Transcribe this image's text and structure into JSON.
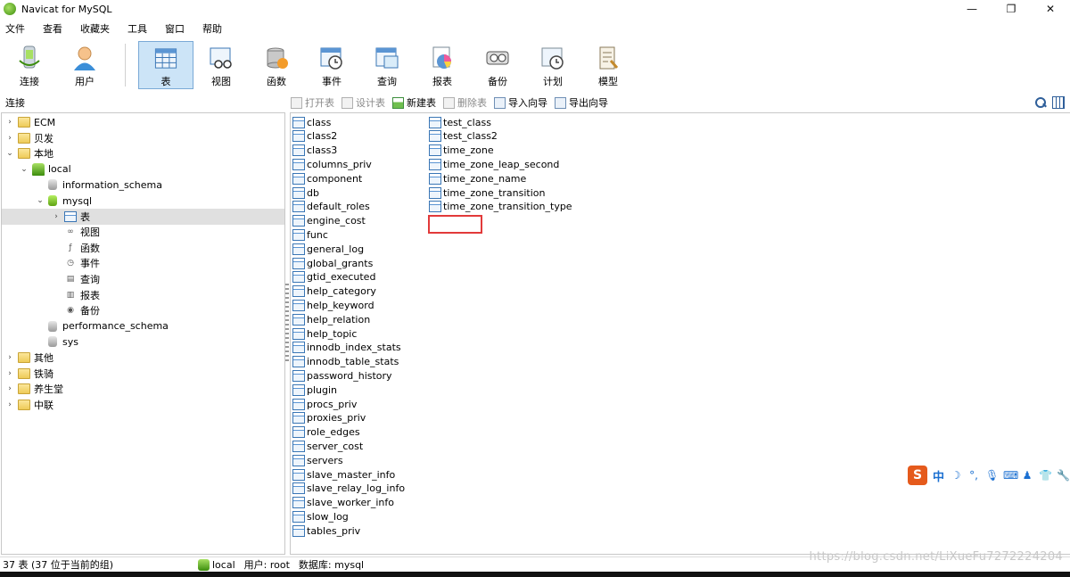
{
  "window": {
    "title": "Navicat for MySQL"
  },
  "menu": [
    "文件",
    "查看",
    "收藏夹",
    "工具",
    "窗口",
    "帮助"
  ],
  "toolbar": {
    "primary": [
      {
        "label": "连接",
        "icon": "connection-icon"
      },
      {
        "label": "用户",
        "icon": "user-icon"
      }
    ],
    "secondary": [
      {
        "label": "表",
        "icon": "table-icon",
        "active": true
      },
      {
        "label": "视图",
        "icon": "view-icon"
      },
      {
        "label": "函数",
        "icon": "function-icon"
      },
      {
        "label": "事件",
        "icon": "event-icon"
      },
      {
        "label": "查询",
        "icon": "query-icon"
      },
      {
        "label": "报表",
        "icon": "report-icon"
      },
      {
        "label": "备份",
        "icon": "backup-icon"
      },
      {
        "label": "计划",
        "icon": "schedule-icon"
      },
      {
        "label": "模型",
        "icon": "model-icon"
      }
    ]
  },
  "left_panel": {
    "header": "连接"
  },
  "tree": [
    {
      "label": "ECM",
      "level": 0,
      "arrow": "›",
      "icon": "folder"
    },
    {
      "label": "贝发",
      "level": 0,
      "arrow": "›",
      "icon": "folder"
    },
    {
      "label": "本地",
      "level": 0,
      "arrow": "⌄",
      "icon": "folder"
    },
    {
      "label": "local",
      "level": 1,
      "arrow": "⌄",
      "icon": "server"
    },
    {
      "label": "information_schema",
      "level": 2,
      "arrow": "",
      "icon": "db"
    },
    {
      "label": "mysql",
      "level": 2,
      "arrow": "⌄",
      "icon": "db-open"
    },
    {
      "label": "表",
      "level": 3,
      "arrow": "›",
      "icon": "table",
      "selected": true
    },
    {
      "label": "视图",
      "level": 3,
      "arrow": "",
      "icon": "view"
    },
    {
      "label": "函数",
      "level": 3,
      "arrow": "",
      "icon": "function"
    },
    {
      "label": "事件",
      "level": 3,
      "arrow": "",
      "icon": "event"
    },
    {
      "label": "查询",
      "level": 3,
      "arrow": "",
      "icon": "query"
    },
    {
      "label": "报表",
      "level": 3,
      "arrow": "",
      "icon": "report"
    },
    {
      "label": "备份",
      "level": 3,
      "arrow": "",
      "icon": "backup"
    },
    {
      "label": "performance_schema",
      "level": 2,
      "arrow": "",
      "icon": "db"
    },
    {
      "label": "sys",
      "level": 2,
      "arrow": "",
      "icon": "db"
    },
    {
      "label": "其他",
      "level": 0,
      "arrow": "›",
      "icon": "folder"
    },
    {
      "label": "铁骑",
      "level": 0,
      "arrow": "›",
      "icon": "folder"
    },
    {
      "label": "养生堂",
      "level": 0,
      "arrow": "›",
      "icon": "folder"
    },
    {
      "label": "中联",
      "level": 0,
      "arrow": "›",
      "icon": "folder"
    }
  ],
  "object_toolbar": [
    {
      "label": "打开表",
      "enabled": false
    },
    {
      "label": "设计表",
      "enabled": false
    },
    {
      "label": "新建表",
      "enabled": true
    },
    {
      "label": "删除表",
      "enabled": false
    },
    {
      "label": "导入向导",
      "enabled": true
    },
    {
      "label": "导出向导",
      "enabled": true
    }
  ],
  "tables_col1": [
    "class",
    "class2",
    "class3",
    "columns_priv",
    "component",
    "db",
    "default_roles",
    "engine_cost",
    "func",
    "general_log",
    "global_grants",
    "gtid_executed",
    "help_category",
    "help_keyword",
    "help_relation",
    "help_topic",
    "innodb_index_stats",
    "innodb_table_stats",
    "password_history",
    "plugin",
    "procs_priv",
    "proxies_priv",
    "role_edges",
    "server_cost",
    "servers",
    "slave_master_info",
    "slave_relay_log_info",
    "slave_worker_info",
    "slow_log",
    "tables_priv"
  ],
  "tables_col2": [
    "test_class",
    "test_class2",
    "time_zone",
    "time_zone_leap_second",
    "time_zone_name",
    "time_zone_transition",
    "time_zone_transition_type"
  ],
  "ime": {
    "logo": "S",
    "mode": "中"
  },
  "statusbar": {
    "count": "37 表 (37 位于当前的组)",
    "connection": "local",
    "user": "用户: root",
    "database": "数据库: mysql"
  },
  "watermark": "https://blog.csdn.net/LiXueFu7272224204"
}
